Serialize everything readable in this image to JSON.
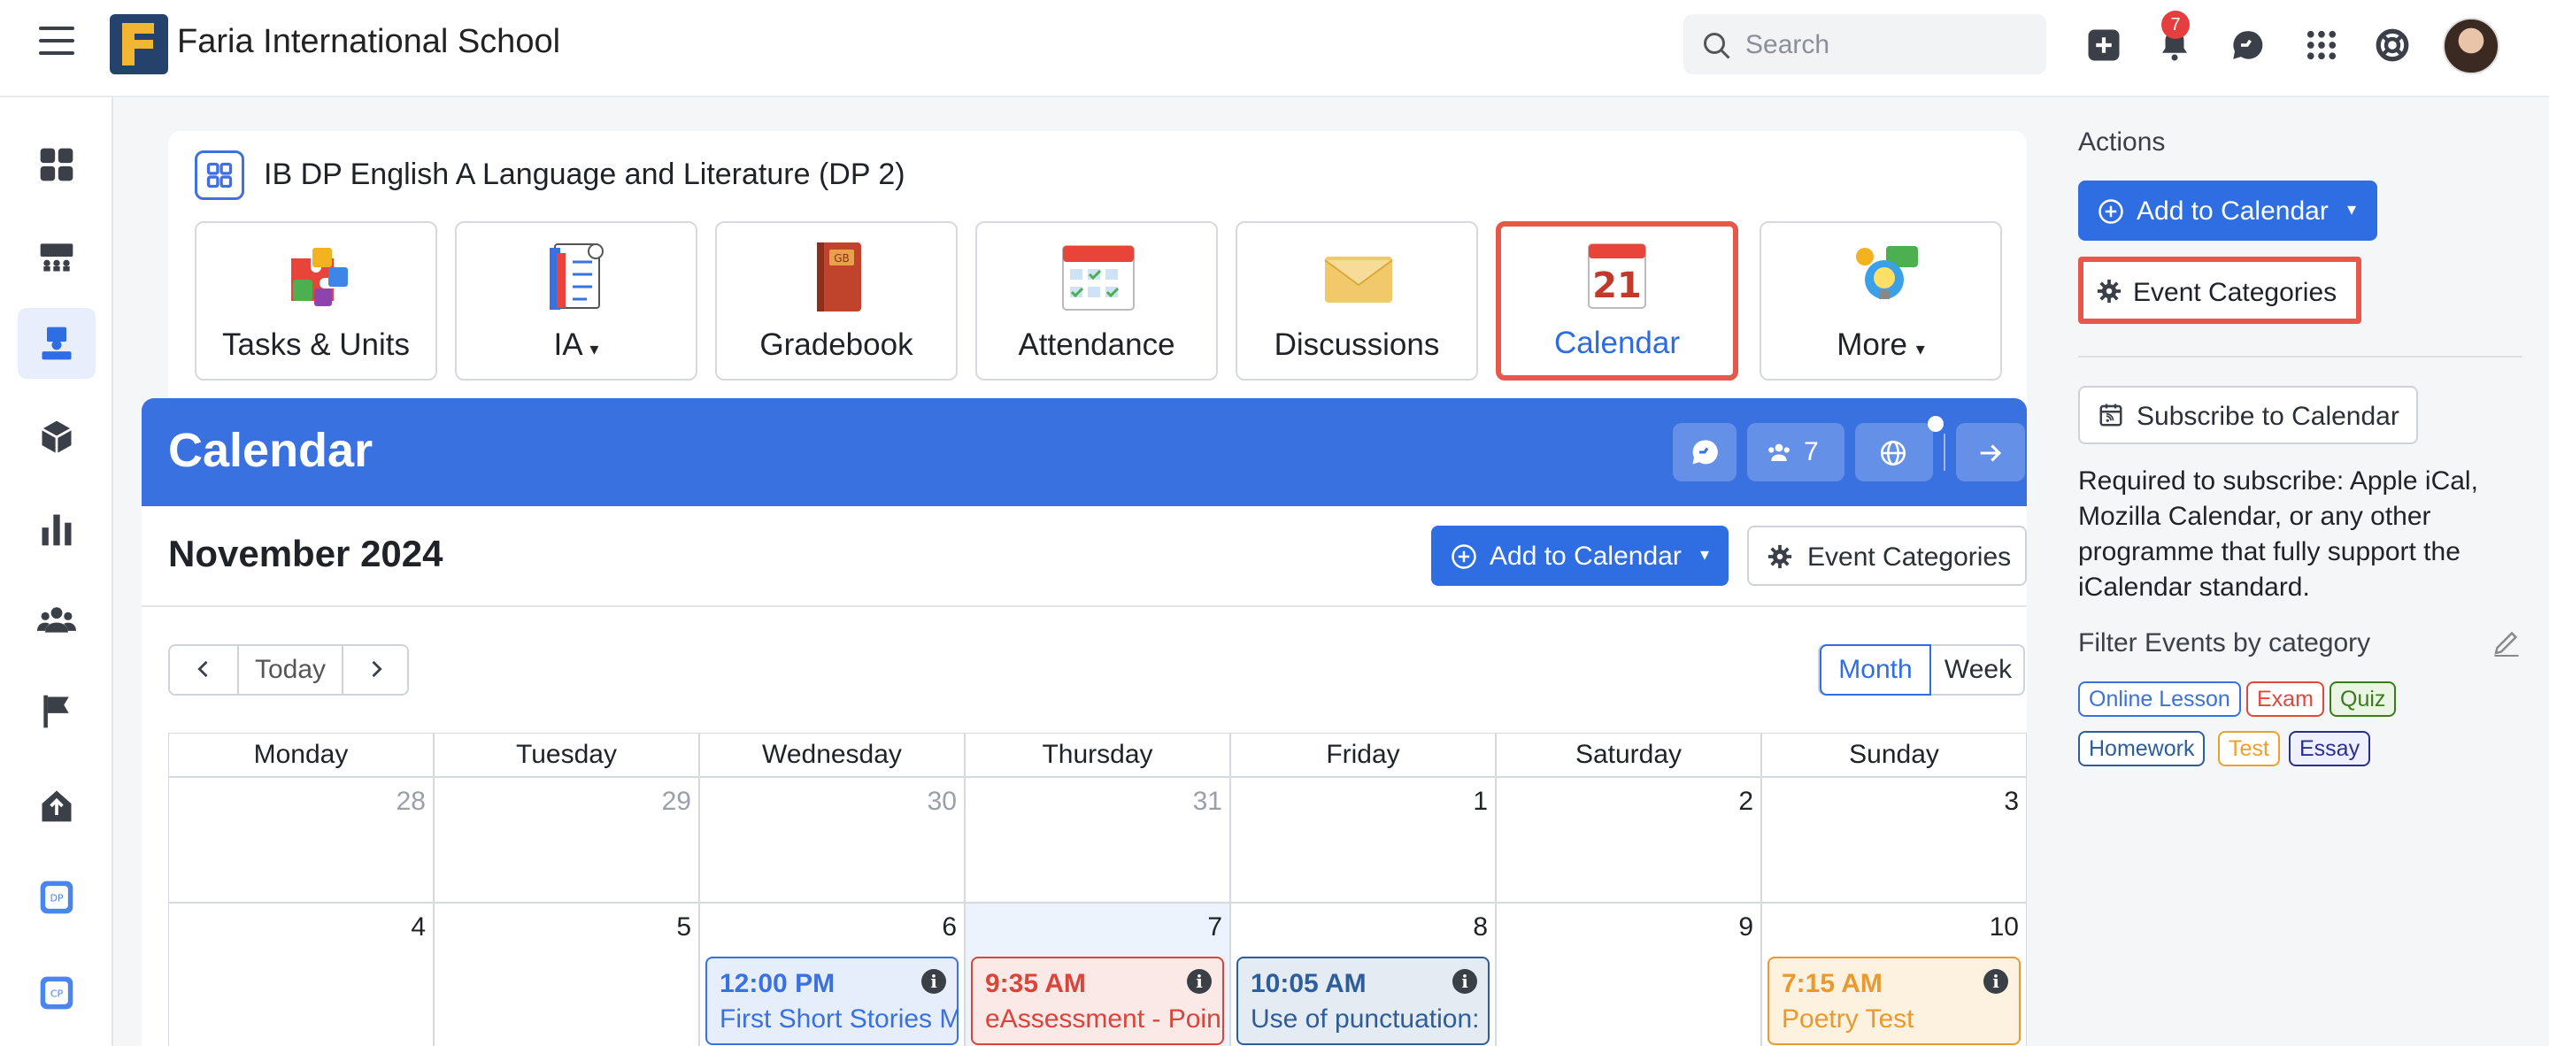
{
  "app": {
    "school_name": "Faria International School",
    "search_placeholder": "Search",
    "notifications_count": "7"
  },
  "sidebar": {
    "items": [
      "dashboard-icon",
      "classes-icon",
      "course-icon",
      "package-icon",
      "reports-icon",
      "people-icon",
      "flag-icon",
      "home-upload-icon",
      "dp-icon",
      "cp-icon"
    ],
    "active_index": 2
  },
  "course": {
    "title": "IB DP English A Language and Literature (DP 2)",
    "tiles": [
      {
        "label": "Tasks & Units",
        "icon": "puzzle-icon"
      },
      {
        "label": "IA",
        "icon": "ia-notebook-icon",
        "dropdown": true
      },
      {
        "label": "Gradebook",
        "icon": "gradebook-icon"
      },
      {
        "label": "Attendance",
        "icon": "attendance-icon"
      },
      {
        "label": "Discussions",
        "icon": "envelope-icon"
      },
      {
        "label": "Calendar",
        "icon": "calendar-icon",
        "selected": true
      },
      {
        "label": "More",
        "icon": "lightbulb-icon",
        "dropdown": true
      }
    ]
  },
  "calendar": {
    "title": "Calendar",
    "members_count": "7",
    "month_title": "November 2024",
    "add_label": "Add to Calendar",
    "categories_label": "Event Categories",
    "today_label": "Today",
    "view_month": "Month",
    "view_week": "Week",
    "days": [
      "Monday",
      "Tuesday",
      "Wednesday",
      "Thursday",
      "Friday",
      "Saturday",
      "Sunday"
    ],
    "week1": [
      "28",
      "29",
      "30",
      "31",
      "1",
      "2",
      "3"
    ],
    "week2": [
      "4",
      "5",
      "6",
      "7",
      "8",
      "9",
      "10"
    ],
    "events": [
      {
        "day_index": 2,
        "time": "12:00 PM",
        "name": "First Short Stories M",
        "color": "#3a71e0",
        "bg": "#e6eefb"
      },
      {
        "day_index": 3,
        "time": "9:35 AM",
        "name": "eAssessment - Poin",
        "color": "#d9453a",
        "bg": "#fbe9e8"
      },
      {
        "day_index": 4,
        "time": "10:05 AM",
        "name": "Use of punctuation:",
        "color": "#2d5d9a",
        "bg": "#e4ebf3"
      },
      {
        "day_index": 6,
        "time": "7:15 AM",
        "name": "Poetry Test",
        "color": "#e99a2e",
        "bg": "#fdf1df"
      }
    ]
  },
  "actions": {
    "heading": "Actions",
    "add_label": "Add to Calendar",
    "categories_label": "Event Categories",
    "subscribe_label": "Subscribe to Calendar",
    "note": "Required to subscribe: Apple iCal, Mozilla Calendar, or any other programme that fully support the iCalendar standard.",
    "filter_heading": "Filter Events by category",
    "tags": [
      {
        "label": "Online Lesson",
        "color": "#3a71e0"
      },
      {
        "label": "Exam",
        "color": "#e0483c"
      },
      {
        "label": "Quiz",
        "color": "#3b7a1f"
      },
      {
        "label": "Homework",
        "color": "#2d5d9a"
      },
      {
        "label": "Test",
        "color": "#f0a02a"
      },
      {
        "label": "Essay",
        "color": "#2a2f8f"
      }
    ]
  }
}
